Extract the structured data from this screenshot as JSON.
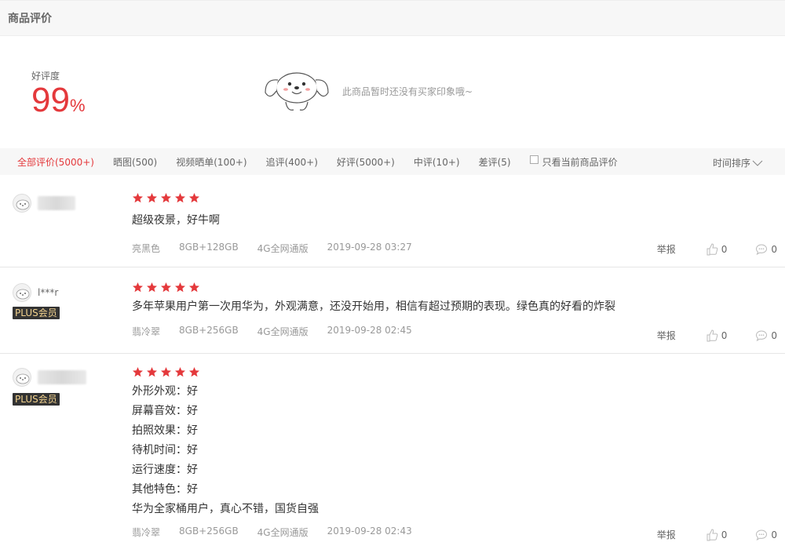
{
  "header": {
    "title": "商品评价"
  },
  "summary": {
    "rate_label": "好评度",
    "rate_value": "99",
    "rate_unit": "%",
    "empty_text": "此商品暂时还没有买家印象哦~"
  },
  "filters": {
    "tabs": [
      {
        "label": "全部评价(5000+)",
        "active": true
      },
      {
        "label": "晒图(500)"
      },
      {
        "label": "视频晒单(100+)"
      },
      {
        "label": "追评(400+)"
      },
      {
        "label": "好评(5000+)"
      },
      {
        "label": "中评(10+)"
      },
      {
        "label": "差评(5)"
      }
    ],
    "only_current": "只看当前商品评价",
    "sort": "时间排序"
  },
  "reviews": [
    {
      "username": "",
      "plus": "",
      "stars": 5,
      "content": [
        "超级夜景，好牛啊"
      ],
      "color": "亮黑色",
      "storage": "8GB+128GB",
      "network": "4G全网通版",
      "time": "2019-09-28 03:27",
      "report": "举报",
      "likes": "0",
      "comments": "0"
    },
    {
      "username": "l***r",
      "plus": "PLUS会员",
      "stars": 5,
      "content": [
        "多年苹果用户第一次用华为，外观满意，还没开始用，相信有超过预期的表现。绿色真的好看的炸裂"
      ],
      "color": "翡冷翠",
      "storage": "8GB+256GB",
      "network": "4G全网通版",
      "time": "2019-09-28 02:45",
      "report": "举报",
      "likes": "0",
      "comments": "0"
    },
    {
      "username": "",
      "plus": "PLUS会员",
      "stars": 5,
      "content": [
        "外形外观：好",
        "屏幕音效：好",
        "拍照效果：好",
        "待机时间：好",
        "运行速度：好",
        "其他特色：好",
        "华为全家桶用户，真心不错，国货自强"
      ],
      "color": "翡冷翠",
      "storage": "8GB+256GB",
      "network": "4G全网通版",
      "time": "2019-09-28 02:43",
      "report": "举报",
      "likes": "0",
      "comments": "0"
    }
  ],
  "colors": {
    "accent": "#e4393c",
    "plus_bg": "#333333",
    "plus_text": "#f3d38f"
  }
}
